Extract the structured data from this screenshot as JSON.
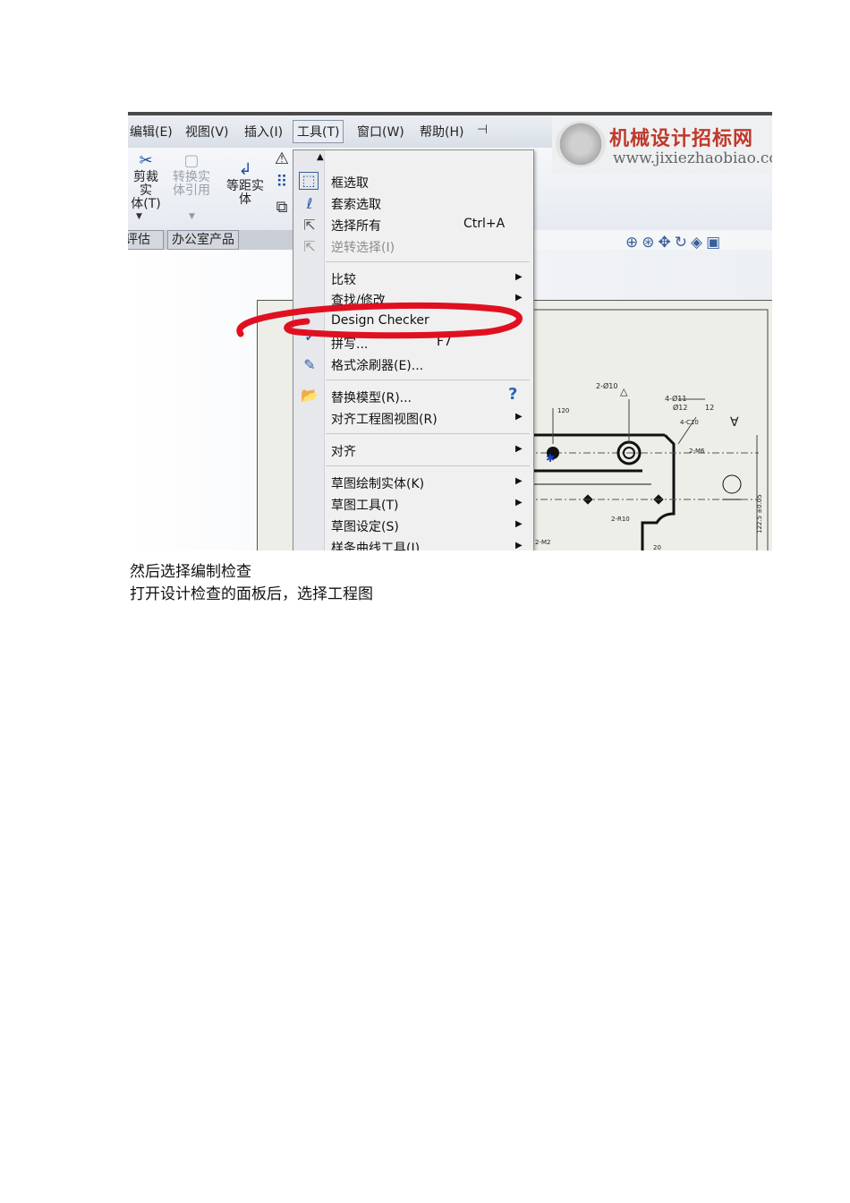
{
  "menubar": {
    "items": [
      "编辑(E)",
      "视图(V)",
      "插入(I)",
      "工具(T)",
      "窗口(W)",
      "帮助(H)"
    ],
    "active_index": 3
  },
  "logo": {
    "title": "机械设计招标网",
    "url": "www.jixiezhaobiao.com"
  },
  "toolbar": {
    "buttons": [
      {
        "label": "剪裁实\n体(T)",
        "icon": "trim-entities-icon",
        "enabled": true
      },
      {
        "label": "转换实\n体引用",
        "icon": "convert-entities-icon",
        "enabled": false
      },
      {
        "label": "等距实\n体",
        "icon": "offset-entities-icon",
        "enabled": true
      }
    ]
  },
  "tabs": [
    "评估",
    "办公室产品"
  ],
  "tools_menu": {
    "items": [
      {
        "label": "框选取",
        "icon": "box-select-icon"
      },
      {
        "label": "套索选取",
        "icon": "lasso-select-icon"
      },
      {
        "label": "选择所有",
        "icon": "select-all-icon",
        "shortcut": "Ctrl+A"
      },
      {
        "label": "逆转选择(I)",
        "icon": "invert-select-icon",
        "disabled": true
      },
      {
        "label": "比较",
        "submenu": true
      },
      {
        "label": "查找/修改",
        "submenu": true
      },
      {
        "label": "Design Checker",
        "highlighted_annotation": true
      },
      {
        "label": "拼写...",
        "icon": "spell-check-icon",
        "shortcut": "F7"
      },
      {
        "label": "格式涂刷器(E)...",
        "icon": "format-painter-icon"
      },
      {
        "label": "替换模型(R)...",
        "icon": "replace-model-icon"
      },
      {
        "label": "对齐工程图视图(R)",
        "submenu": true
      },
      {
        "label": "对齐",
        "submenu": true
      },
      {
        "label": "草图绘制实体(K)",
        "submenu": true
      },
      {
        "label": "草图工具(T)",
        "submenu": true
      },
      {
        "label": "草图设定(S)",
        "submenu": true
      },
      {
        "label": "样条曲线工具(I)",
        "submenu": true
      }
    ]
  },
  "drawing": {
    "labels": [
      "2-Ø10",
      "120",
      "4-Ø11",
      "Ø12",
      "12",
      "4-C10",
      "2-M6",
      "2-R10",
      "2-M2",
      "20",
      "122.5 ±0.05"
    ]
  },
  "captions": [
    "然后选择编制检查",
    "打开设计检查的面板后，选择工程图"
  ],
  "colors": {
    "annotation_red": "#e01020",
    "logo_red": "#c0392b",
    "menu_bg": "#f0f0f0"
  }
}
